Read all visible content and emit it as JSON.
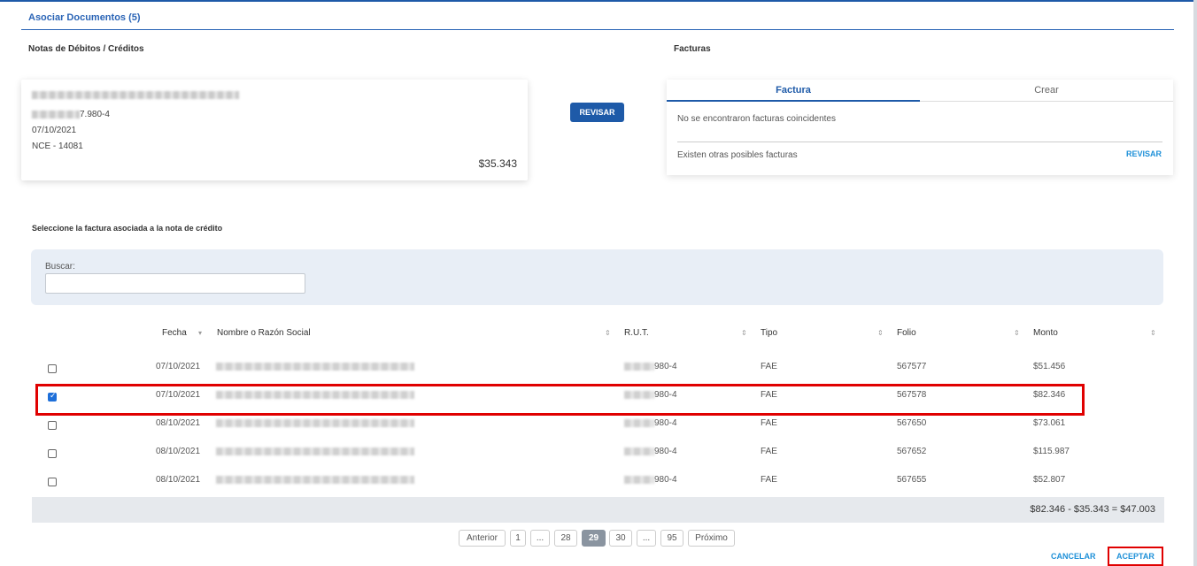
{
  "tab": {
    "label": "Asociar Documentos (5)"
  },
  "left_section": {
    "title": "Notas de Débitos / Créditos"
  },
  "note_card": {
    "rut_suffix": "7.980-4",
    "date": "07/10/2021",
    "doc_number": "NCE - 14081",
    "amount": "$35.343"
  },
  "revisar_button": "REVISAR",
  "right_section": {
    "title": "Facturas"
  },
  "facturas_panel": {
    "tab_factura": "Factura",
    "tab_crear": "Crear",
    "no_match": "No se encontraron facturas coincidentes",
    "other_possible": "Existen otras posibles facturas",
    "revisar_link": "REVISAR"
  },
  "select_prompt": "Seleccione la factura asociada a la nota de crédito",
  "search": {
    "label": "Buscar:",
    "value": "",
    "placeholder": ""
  },
  "table": {
    "headers": {
      "fecha": "Fecha",
      "nombre": "Nombre o Razón Social",
      "rut": "R.U.T.",
      "tipo": "Tipo",
      "folio": "Folio",
      "monto": "Monto"
    },
    "rows": [
      {
        "checked": false,
        "fecha": "07/10/2021",
        "rut": "980-4",
        "tipo": "FAE",
        "folio": "567577",
        "monto": "$51.456"
      },
      {
        "checked": true,
        "fecha": "07/10/2021",
        "rut": "980-4",
        "tipo": "FAE",
        "folio": "567578",
        "monto": "$82.346"
      },
      {
        "checked": false,
        "fecha": "08/10/2021",
        "rut": "980-4",
        "tipo": "FAE",
        "folio": "567650",
        "monto": "$73.061"
      },
      {
        "checked": false,
        "fecha": "08/10/2021",
        "rut": "980-4",
        "tipo": "FAE",
        "folio": "567652",
        "monto": "$115.987"
      },
      {
        "checked": false,
        "fecha": "08/10/2021",
        "rut": "980-4",
        "tipo": "FAE",
        "folio": "567655",
        "monto": "$52.807"
      }
    ]
  },
  "totals": "$82.346 - $35.343 = $47.003",
  "pagination": {
    "prev": "Anterior",
    "pages": [
      "1",
      "...",
      "28",
      "29",
      "30",
      "...",
      "95"
    ],
    "current": "29",
    "next": "Próximo"
  },
  "actions": {
    "cancel": "CANCELAR",
    "accept": "ACEPTAR"
  },
  "colors": {
    "primary": "#1e5aa8",
    "link": "#1e90d8",
    "highlight": "#e00000"
  }
}
